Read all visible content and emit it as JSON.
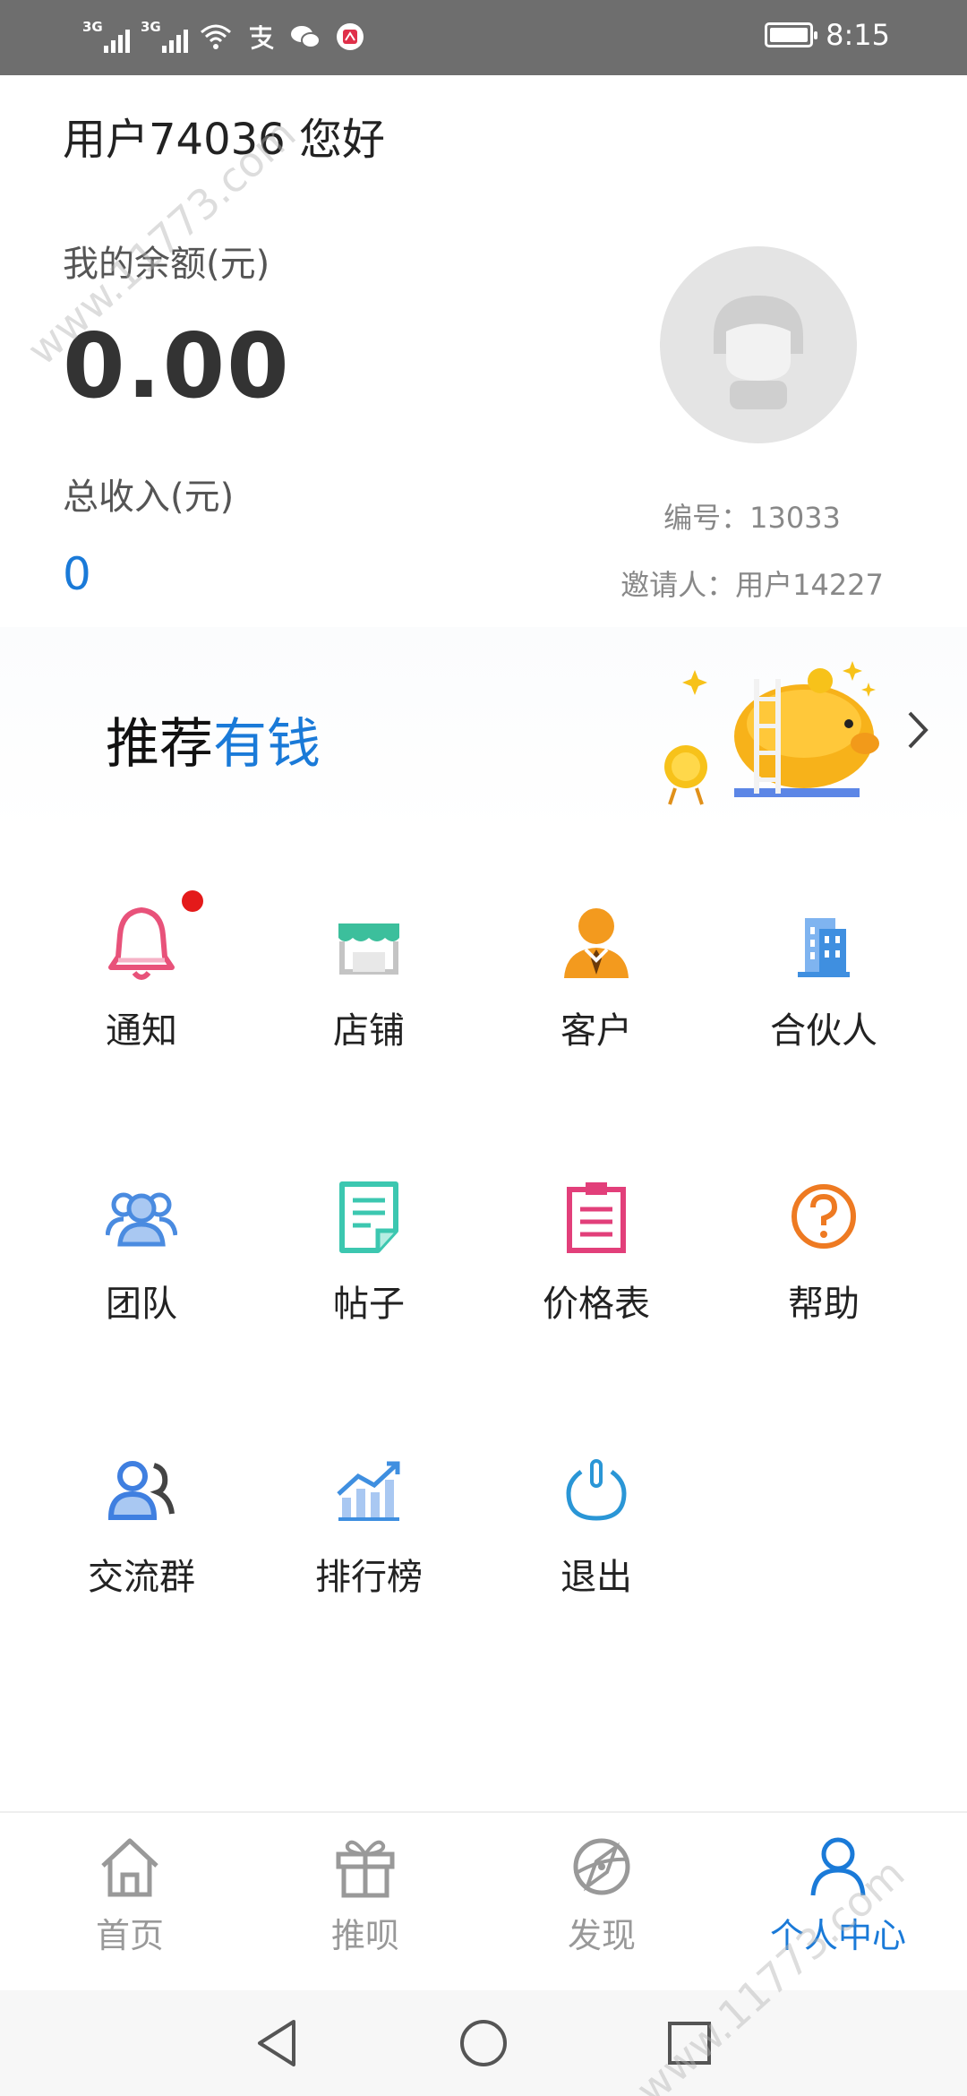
{
  "status_bar": {
    "signal_1": "3G",
    "signal_2": "3G",
    "time": "8:15",
    "icons": [
      "signal-icon",
      "signal-icon",
      "wifi-icon",
      "alipay-icon",
      "wechat-icon",
      "app-notification-icon",
      "battery-icon"
    ]
  },
  "header": {
    "greeting": "用户74036 您好",
    "balance_label": "我的余额(元)",
    "balance_value": "0.00",
    "income_label": "总收入(元)",
    "income_value": "0",
    "user_id": "编号：13033",
    "inviter": "邀请人：用户14227"
  },
  "banner": {
    "title_main": "推荐",
    "title_accent": "有钱"
  },
  "menu": [
    {
      "label": "通知",
      "icon": "bell-icon",
      "color": "#e8527a",
      "badge": true
    },
    {
      "label": "店铺",
      "icon": "store-icon",
      "color": "#3cbf9c"
    },
    {
      "label": "客户",
      "icon": "customer-icon",
      "color": "#f39a1e"
    },
    {
      "label": "合伙人",
      "icon": "building-icon",
      "color": "#3f8fe0"
    },
    {
      "label": "团队",
      "icon": "team-icon",
      "color": "#4a8be0"
    },
    {
      "label": "帖子",
      "icon": "post-icon",
      "color": "#3cc7b0"
    },
    {
      "label": "价格表",
      "icon": "clipboard-icon",
      "color": "#e23f7a"
    },
    {
      "label": "帮助",
      "icon": "help-icon",
      "color": "#ee7a22"
    },
    {
      "label": "交流群",
      "icon": "group-chat-icon",
      "color": "#3f7fe0"
    },
    {
      "label": "排行榜",
      "icon": "ranking-icon",
      "color": "#3f8fe0"
    },
    {
      "label": "退出",
      "icon": "power-icon",
      "color": "#2a96d6"
    }
  ],
  "tabbar": {
    "tabs": [
      {
        "label": "首页",
        "icon": "home-icon"
      },
      {
        "label": "推呗",
        "icon": "gift-icon"
      },
      {
        "label": "发现",
        "icon": "compass-icon"
      },
      {
        "label": "个人中心",
        "icon": "person-icon",
        "active": true
      }
    ]
  },
  "watermark": "www.11773.com",
  "colors": {
    "accent": "#1a7ad8",
    "status_bar": "#6e6e6e",
    "badge": "#e41a1a"
  }
}
